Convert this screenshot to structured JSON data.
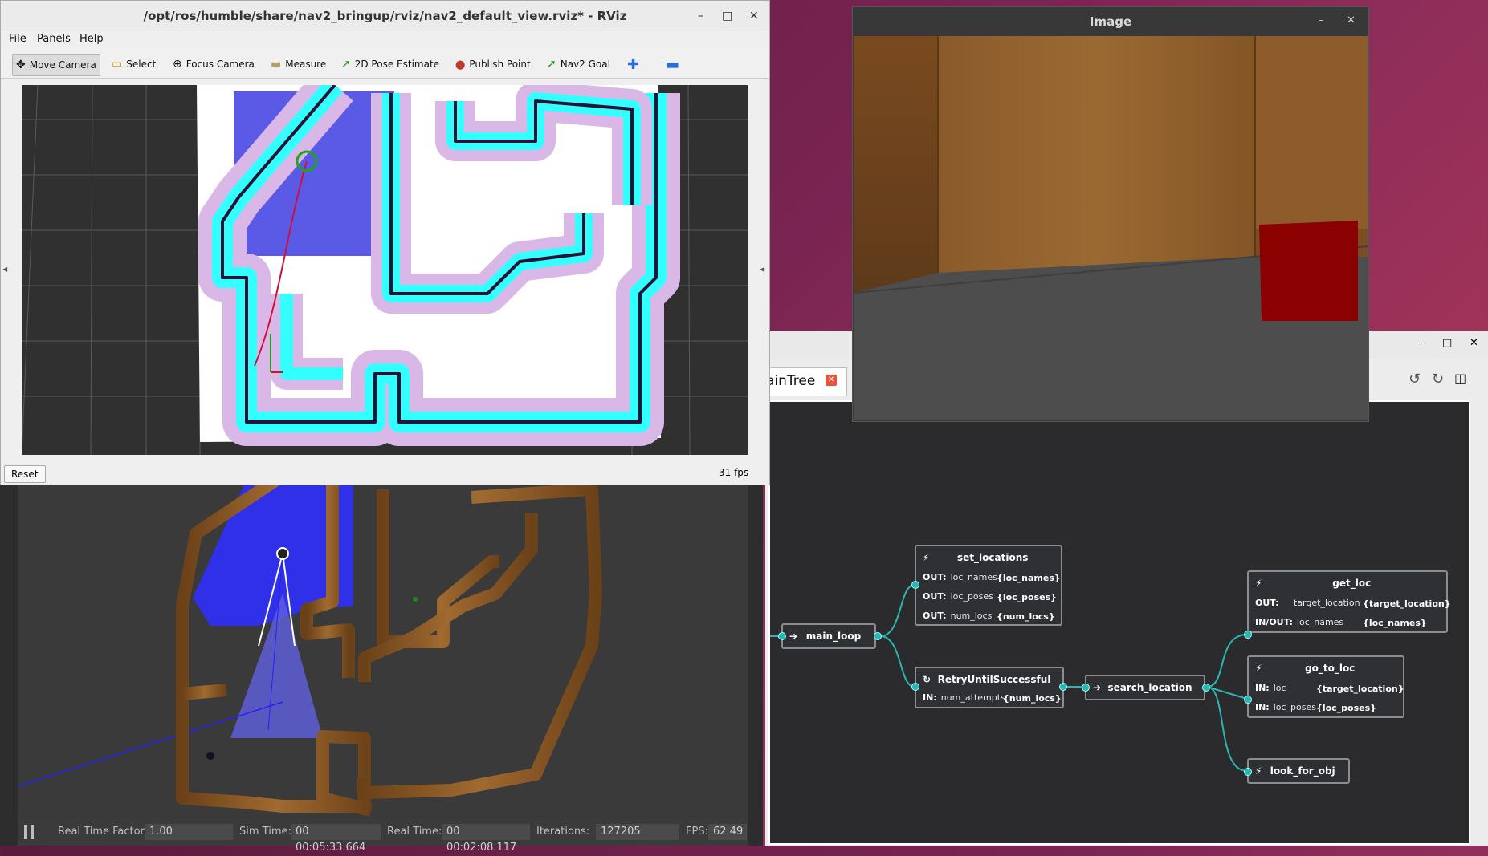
{
  "colors": {
    "accent_teal": "#2bb6b1",
    "lidar_blue": "#3a3ae0",
    "wall_wood": "#8a5a26"
  },
  "gazebo": {
    "status": {
      "pause_icon": "pause-icon",
      "rtf_label": "Real Time Factor:",
      "rtf_value": "1.00",
      "sim_label": "Sim Time:",
      "sim_value": "00 00:05:33.664",
      "real_label": "Real Time:",
      "real_value": "00 00:02:08.117",
      "iter_label": "Iterations:",
      "iter_value": "127205",
      "fps_label": "FPS:",
      "fps_value": "62.49"
    }
  },
  "image_window": {
    "title": "Image",
    "minimize": "–",
    "maximize": "□",
    "close": "✕"
  },
  "rviz": {
    "title": "/opt/ros/humble/share/nav2_bringup/rviz/nav2_default_view.rviz* - RViz",
    "window_buttons": {
      "minimize": "–",
      "maximize": "□",
      "close": "✕"
    },
    "menu": [
      "File",
      "Panels",
      "Help"
    ],
    "tools": [
      {
        "label": "Move Camera",
        "icon": "move-camera-icon",
        "glyph": "✥"
      },
      {
        "label": "Select",
        "icon": "select-icon",
        "glyph": "▭"
      },
      {
        "label": "Focus Camera",
        "icon": "focus-camera-icon",
        "glyph": "⊕"
      },
      {
        "label": "Measure",
        "icon": "measure-icon",
        "glyph": "▬"
      },
      {
        "label": "2D Pose Estimate",
        "icon": "pose-estimate-icon",
        "glyph": "➚"
      },
      {
        "label": "Publish Point",
        "icon": "publish-point-icon",
        "glyph": "⬤"
      },
      {
        "label": "Nav2 Goal",
        "icon": "nav2-goal-icon",
        "glyph": "➚"
      }
    ],
    "reset_label": "Reset",
    "fps": "31 fps"
  },
  "groot": {
    "tab_label": "ainTree",
    "tab_close": "✕",
    "window_buttons": {
      "minimize": "–",
      "maximize": "□",
      "close": "✕"
    },
    "nodes": {
      "main_loop": {
        "title": "main_loop"
      },
      "set_locations": {
        "title": "set_locations",
        "ports": [
          {
            "dir": "OUT:",
            "name": "loc_names",
            "value": "{loc_names}"
          },
          {
            "dir": "OUT:",
            "name": "loc_poses",
            "value": "{loc_poses}"
          },
          {
            "dir": "OUT:",
            "name": "num_locs",
            "value": "{num_locs}"
          }
        ]
      },
      "retry": {
        "title": "RetryUntilSuccessful",
        "ports": [
          {
            "dir": "IN:",
            "name": "num_attempts",
            "value": "{num_locs}"
          }
        ]
      },
      "search_location": {
        "title": "search_location"
      },
      "get_loc": {
        "title": "get_loc",
        "ports": [
          {
            "dir": "OUT:",
            "name": "target_location",
            "value": "{target_location}"
          },
          {
            "dir": "IN/OUT:",
            "name": "loc_names",
            "value": "{loc_names}"
          }
        ]
      },
      "go_to_loc": {
        "title": "go_to_loc",
        "ports": [
          {
            "dir": "IN:",
            "name": "loc",
            "value": "{target_location}"
          },
          {
            "dir": "IN:",
            "name": "loc_poses",
            "value": "{loc_poses}"
          }
        ]
      },
      "look_for_obj": {
        "title": "look_for_obj"
      }
    }
  }
}
